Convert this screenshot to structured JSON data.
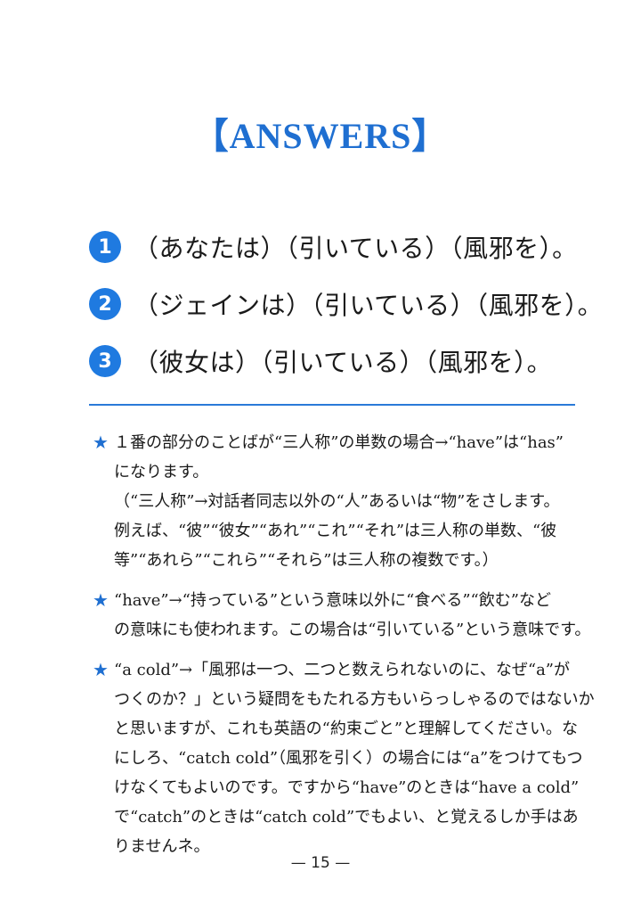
{
  "title": "【ANSWERS】",
  "answers": [
    {
      "num": "1",
      "text": "（あなたは）（引いている）（風邪を）。"
    },
    {
      "num": "2",
      "text": "（ジェインは）（引いている）（風邪を）。"
    },
    {
      "num": "3",
      "text": "（彼女は）（引いている）（風邪を）。"
    }
  ],
  "notes": [
    {
      "star": "★",
      "lines": [
        "１番の部分のことばが“三人称”の単数の場合→“have”は“has”",
        "になります。",
        "（“三人称”→対話者同志以外の“人”あるいは“物”をさします。",
        "例えば、“彼”“彼女”“あれ”“これ”“それ”は三人称の単数、“彼",
        "等”“あれら”“これら”“それら”は三人称の複数です。）"
      ]
    },
    {
      "star": "★",
      "lines": [
        "“have”→“持っている”という意味以外に“食べる”“飲む”など",
        "の意味にも使われます。この場合は“引いている”という意味です。"
      ]
    },
    {
      "star": "★",
      "lines": [
        "“a cold”→「風邪は一つ、二つと数えられないのに、なぜ“a”が",
        "つくのか？」という疑問をもたれる方もいらっしゃるのではないか",
        "と思いますが、これも英語の“約束ごと”と理解してください。な",
        "にしろ、“catch cold”（風邪を引く）の場合には“a”をつけてもつ",
        "けなくてもよいのです。ですから“have”のときは“have a cold”",
        "で“catch”のときは“catch cold”でもよい、と覚えるしか手はあ",
        "りませんネ。"
      ]
    }
  ],
  "page_number": "— 15 —",
  "colors": {
    "accent": "#1f6fd1",
    "badge": "#1f7ae0",
    "rule": "#2a7ad8"
  }
}
